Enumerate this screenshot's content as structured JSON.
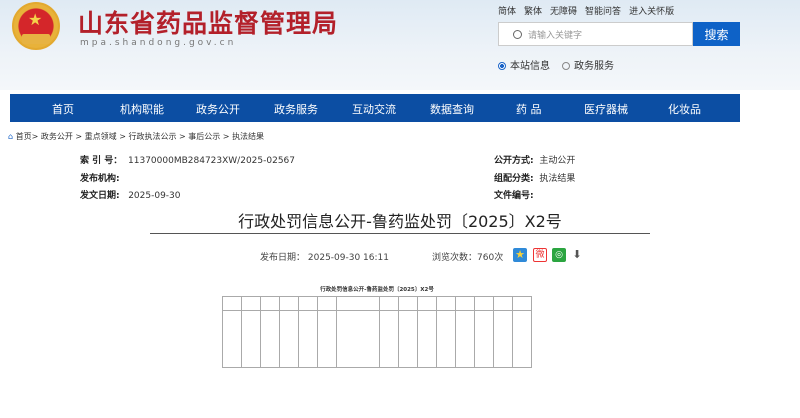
{
  "header": {
    "site_title": "山东省药品监督管理局",
    "site_url": "mpa.shandong.gov.cn",
    "top_links": [
      "简体",
      "繁体",
      "无障碍",
      "智能问答",
      "进入关怀版"
    ],
    "search_placeholder": "请输入关键字",
    "search_button": "搜索",
    "scope_options": [
      {
        "label": "本站信息",
        "selected": true
      },
      {
        "label": "政务服务",
        "selected": false
      }
    ]
  },
  "nav": [
    "首页",
    "机构职能",
    "政务公开",
    "政务服务",
    "互动交流",
    "数据查询",
    "药 品",
    "医疗器械",
    "化妆品"
  ],
  "breadcrumb": [
    "首页>",
    "政务公开 >",
    "重点领域 >",
    "行政执法公示 >",
    "事后公示 >",
    "执法结果"
  ],
  "meta": {
    "index_label": "索 引 号：",
    "index_value": "11370000MB284723XW/2025-02567",
    "publisher_label": "发布机构:",
    "publisher_value": "",
    "date_label": "发文日期:",
    "date_value": "2025-09-30",
    "open_label": "公开方式:",
    "open_value": "主动公开",
    "category_label": "组配分类:",
    "category_value": "执法结果",
    "docno_label": "文件编号:",
    "docno_value": ""
  },
  "article": {
    "title": "行政处罚信息公开-鲁药监处罚〔2025〕X2号",
    "publish_label": "发布日期：",
    "publish_value": "2025-09-30 16:11",
    "views_label": "浏览次数：",
    "views_value": "760次",
    "share_icons": [
      "favorite-icon",
      "weibo-icon",
      "wechat-icon",
      "download-icon"
    ],
    "image_title": "行政处罚信息公开-鲁药监处罚〔2025〕X2号"
  },
  "colors": {
    "nav": "#0c4ea3",
    "title": "#b3202a",
    "search": "#0e62c7"
  }
}
